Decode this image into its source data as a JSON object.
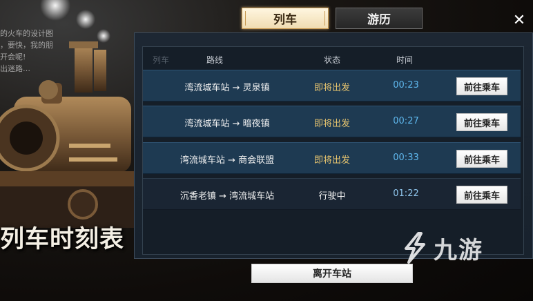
{
  "tabs": {
    "train": "列车",
    "travel": "游历"
  },
  "background_text": {
    "lines": [
      "的火车的设计图",
      "，要快，我的朋",
      "开会呢!",
      "出迷路…"
    ],
    "promo_title": "列车时刻表"
  },
  "table": {
    "headers": {
      "train": "列车",
      "route": "路线",
      "status": "状态",
      "time": "时间"
    },
    "rows": [
      {
        "route": "湾流城车站 → 灵泉镇",
        "status": "即将出发",
        "time": "00:23",
        "action": "前往乘车"
      },
      {
        "route": "湾流城车站 → 暗夜镇",
        "status": "即将出发",
        "time": "00:27",
        "action": "前往乘车"
      },
      {
        "route": "湾流城车站 → 商会联盟",
        "status": "即将出发",
        "time": "00:33",
        "action": "前往乘车"
      },
      {
        "route": "沉香老镇 → 湾流城车站",
        "status": "行驶中",
        "time": "01:22",
        "action": "前往乘车"
      }
    ]
  },
  "leave_button": "离开车站",
  "close_icon": "close-icon",
  "watermark": {
    "text": "九游"
  },
  "colors": {
    "row_active": "#1e3a52",
    "status_departing": "#e8c56f",
    "time": "#5fb8ee",
    "tab_selected": "#f0dcb2"
  }
}
